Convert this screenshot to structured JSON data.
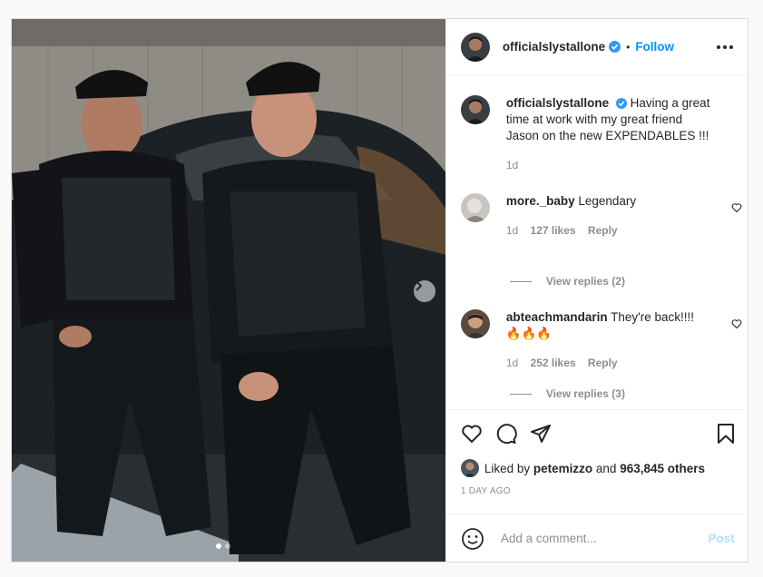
{
  "header": {
    "username": "officialslystallone",
    "separator": "•",
    "follow_label": "Follow",
    "more_icon": "more-options-icon"
  },
  "caption": {
    "username": "officialslystallone",
    "text": "Having a great time at work with my great friend Jason on the new EXPENDABLES !!!",
    "time": "1d"
  },
  "comments": [
    {
      "username": "more._baby",
      "text": "Legendary",
      "time": "1d",
      "likes": "127 likes",
      "reply_label": "Reply",
      "view_replies": "View replies (2)"
    },
    {
      "username": "abteachmandarin",
      "text": "They're back!!!!",
      "emoji": "🔥🔥🔥",
      "time": "1d",
      "likes": "252 likes",
      "reply_label": "Reply",
      "view_replies": "View replies (3)"
    }
  ],
  "actions": {
    "liked_by_prefix": "Liked by",
    "liked_by_user": "petemizzo",
    "and_label": "and",
    "others_count": "963,845 others",
    "timestamp": "1 DAY AGO"
  },
  "add_comment": {
    "placeholder": "Add a comment...",
    "post_label": "Post"
  },
  "colors": {
    "accent": "#0095f6",
    "verified": "#3897f0",
    "post_disabled": "#b2dffc",
    "muted": "#8e8e8e",
    "text": "#262626"
  }
}
